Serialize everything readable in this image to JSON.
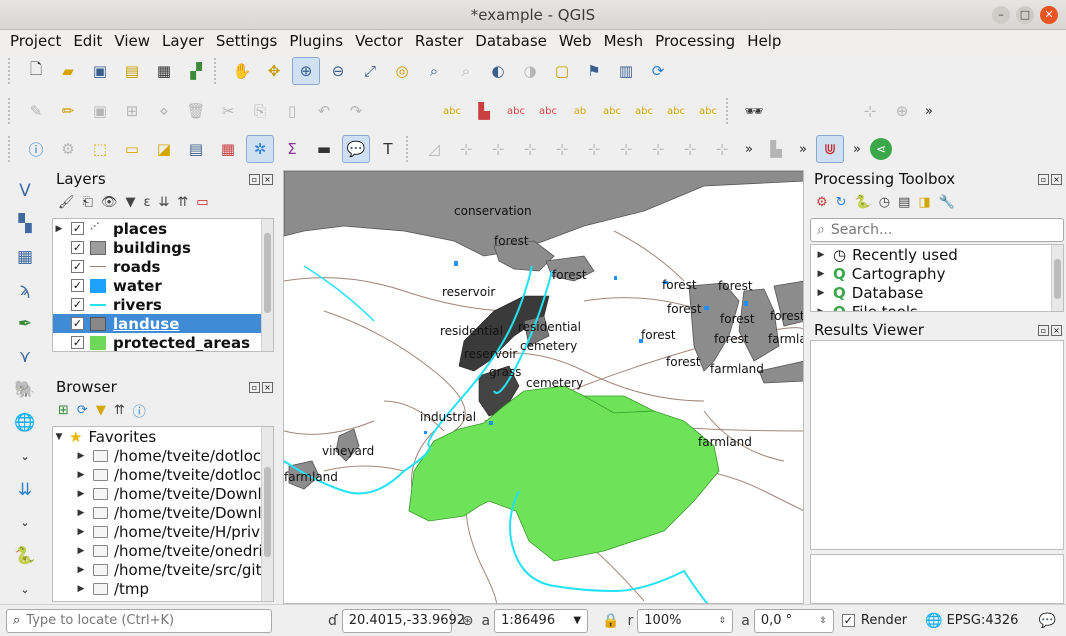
{
  "window": {
    "title": "*example - QGIS",
    "min_icon": "minimize-icon",
    "max_icon": "maximize-icon",
    "close_icon": "close-icon"
  },
  "menu": [
    "Project",
    "Edit",
    "View",
    "Layer",
    "Settings",
    "Plugins",
    "Vector",
    "Raster",
    "Database",
    "Web",
    "Mesh",
    "Processing",
    "Help"
  ],
  "toolbars": {
    "row1": [
      "new-project-icon",
      "open-project-icon",
      "save-project-icon",
      "print-layout-icon",
      "layout-manager-icon",
      "style-manager-icon",
      "pan-icon",
      "pan-to-selection-icon",
      "zoom-in-icon",
      "zoom-out-icon",
      "zoom-full-icon",
      "zoom-layer-icon",
      "zoom-selection-icon",
      "zoom-native-icon",
      "zoom-last-icon",
      "zoom-next-icon",
      "new-map-view-icon",
      "new-bookmark-icon",
      "show-bookmarks-icon",
      "refresh-icon"
    ],
    "row2": [
      "digitize-icon",
      "edit-pencil-icon",
      "save-edits-icon",
      "add-feature-icon",
      "vertex-tool-icon",
      "delete-icon",
      "cut-icon",
      "copy-icon",
      "paste-icon",
      "undo-icon",
      "redo-icon",
      "label-icon",
      "label-color-icon",
      "label-pin-icon",
      "label-show-icon",
      "label-move-icon",
      "label-rotate-icon",
      "label-change-icon",
      "label-edit-icon",
      "spy-icon"
    ],
    "row3": [
      "identify-icon",
      "settings-gear-icon",
      "select-icon",
      "select-by-value-icon",
      "deselect-icon",
      "attribute-table-icon",
      "field-calc-icon",
      "processing-gear-icon",
      "statistics-icon",
      "measure-icon",
      "map-tips-icon",
      "text-annotation-icon",
      "snapping-magnet-icon",
      "share-icon"
    ],
    "more_label": "»"
  },
  "layers_panel": {
    "title": "Layers",
    "layers": [
      {
        "name": "places",
        "checked": true,
        "symbol": "points",
        "color": "#777777"
      },
      {
        "name": "buildings",
        "checked": true,
        "symbol": "fill",
        "color": "#9e9e9e"
      },
      {
        "name": "roads",
        "checked": true,
        "symbol": "line",
        "color": "#a08070"
      },
      {
        "name": "water",
        "checked": true,
        "symbol": "fill",
        "color": "#1e90ff"
      },
      {
        "name": "rivers",
        "checked": true,
        "symbol": "line",
        "color": "#22e2f5"
      },
      {
        "name": "landuse",
        "checked": true,
        "symbol": "fill",
        "color": "#888888",
        "selected": true
      },
      {
        "name": "protected_areas",
        "checked": true,
        "symbol": "fill",
        "color": "#6ed85a"
      }
    ]
  },
  "browser_panel": {
    "title": "Browser",
    "favorites_label": "Favorites",
    "items": [
      "/home/tveite/dotloca",
      "/home/tveite/dotloca",
      "/home/tveite/Downlo",
      "/home/tveite/Downlo",
      "/home/tveite/H/priva",
      "/home/tveite/onedriv",
      "/home/tveite/src/git/",
      "/tmp"
    ]
  },
  "map": {
    "labels": [
      {
        "text": "conservation"
      },
      {
        "text": "forest"
      },
      {
        "text": "forest"
      },
      {
        "text": "reservoir"
      },
      {
        "text": "residential"
      },
      {
        "text": "residential"
      },
      {
        "text": "reservoir"
      },
      {
        "text": "cemetery"
      },
      {
        "text": "grass"
      },
      {
        "text": "cemetery"
      },
      {
        "text": "industrial"
      },
      {
        "text": "vineyard"
      },
      {
        "text": "farmland"
      },
      {
        "text": "forest"
      },
      {
        "text": "forest"
      },
      {
        "text": "forest"
      },
      {
        "text": "forest"
      },
      {
        "text": "forest"
      },
      {
        "text": "forest"
      },
      {
        "text": "forest"
      },
      {
        "text": "farmland"
      },
      {
        "text": "farmland"
      },
      {
        "text": "farmland"
      },
      {
        "text": "forest"
      }
    ],
    "colors": {
      "landuse": "#8c8c8c",
      "protected": "#6ee35a",
      "river": "#22e2f5",
      "road": "#a0867a",
      "water": "#1e90ff",
      "building": "#3a3a3a"
    }
  },
  "processing_toolbox": {
    "title": "Processing Toolbox",
    "search_placeholder": "Search...",
    "items": [
      "Recently used",
      "Cartography",
      "Database",
      "File tools"
    ]
  },
  "results_viewer": {
    "title": "Results Viewer"
  },
  "status": {
    "locate_placeholder": "Type to locate (Ctrl+K)",
    "coordinate_value": "20.4015,-33.9692",
    "scale_value": "1:86496",
    "magnifier_value": "100%",
    "rotation_value": "0,0 °",
    "render_label": "Render",
    "crs_label": "EPSG:4326"
  }
}
